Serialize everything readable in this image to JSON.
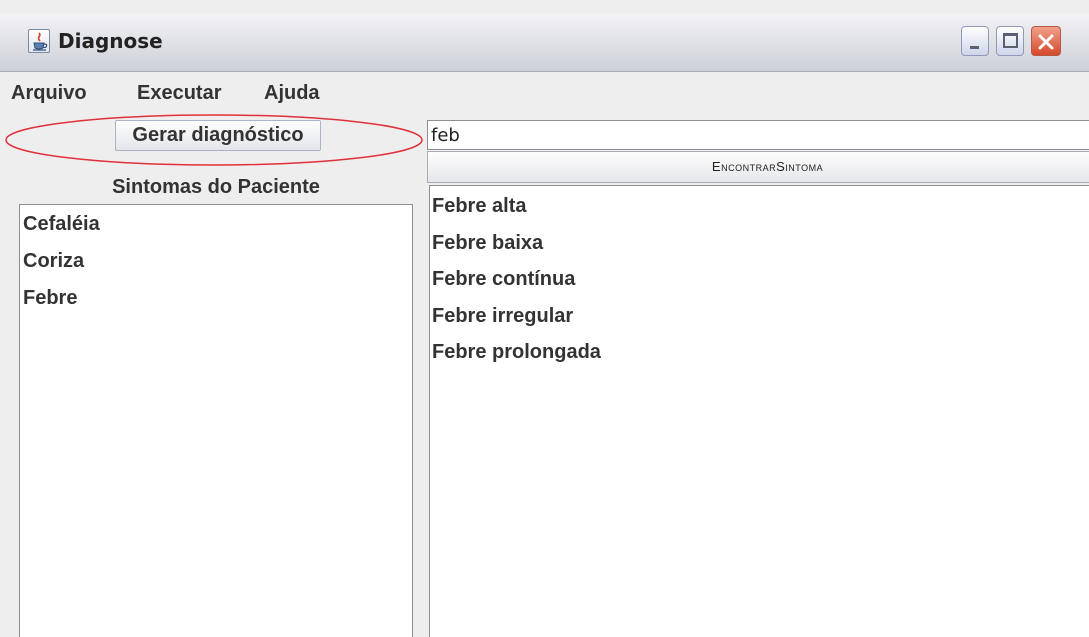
{
  "window": {
    "title": "Diagnose",
    "icon": "java-cup-icon",
    "controls": [
      "minimize-icon",
      "maximize-icon",
      "close-icon"
    ]
  },
  "menu": {
    "items": [
      {
        "label": "Arquivo"
      },
      {
        "label": "Executar"
      },
      {
        "label": "Ajuda"
      }
    ]
  },
  "left_panel": {
    "generate_button_label": "Gerar diagnóstico",
    "highlight_color": "#e0303a",
    "symptoms_heading": "Sintomas do Paciente",
    "symptoms": [
      "Cefaléia",
      "Coriza",
      "Febre"
    ]
  },
  "right_panel": {
    "search_value": "feb",
    "find_button_label": "EncontrarSintoma",
    "results": [
      "Febre alta",
      "Febre baixa",
      "Febre contínua",
      "Febre irregular",
      "Febre prolongada"
    ]
  }
}
